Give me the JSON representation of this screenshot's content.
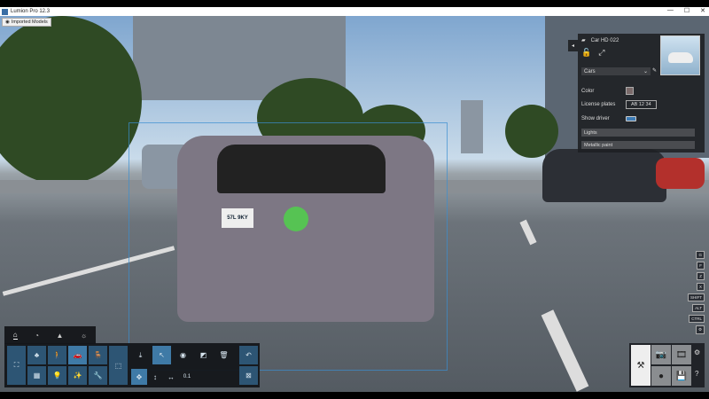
{
  "window": {
    "title": "Lumion Pro 12.3",
    "minimize": "—",
    "maximize": "☐",
    "close": "✕"
  },
  "imported_models_label": "Imported Models",
  "scene": {
    "license_plate_on_car": "57L 9KY"
  },
  "properties_panel": {
    "object_name": "Car HD 022",
    "category": "Cars",
    "color_label": "Color",
    "color_value": "#7a6a6a",
    "license_label": "License plates",
    "license_value": "AB 12 34",
    "show_driver_label": "Show driver",
    "show_driver_on": true,
    "sections": [
      "Lights",
      "Metallic paint"
    ]
  },
  "build_tabs": [
    "⌂",
    "◔",
    "▲",
    "☼"
  ],
  "toolbar": {
    "library": [
      "⛶",
      "♣",
      "🚶",
      "🚗",
      "🪑",
      "▦",
      "💡",
      "✨",
      "🔧"
    ],
    "transform": [
      "⤓",
      "↖",
      "◉",
      "◩",
      "🗑"
    ],
    "sub": [
      "✥",
      "↕",
      "↔",
      "0.1"
    ],
    "undo": "↶",
    "select": "⊠"
  },
  "shortcut_keys": [
    "G",
    "F",
    "Z",
    "X",
    "SHIFT",
    "ALT",
    "CTRL",
    "⚙"
  ],
  "modes": {
    "build": "⚒",
    "photo": "📷",
    "movie": "🎞",
    "360": "●",
    "save": "💾",
    "settings": "⚙",
    "help": "?"
  }
}
